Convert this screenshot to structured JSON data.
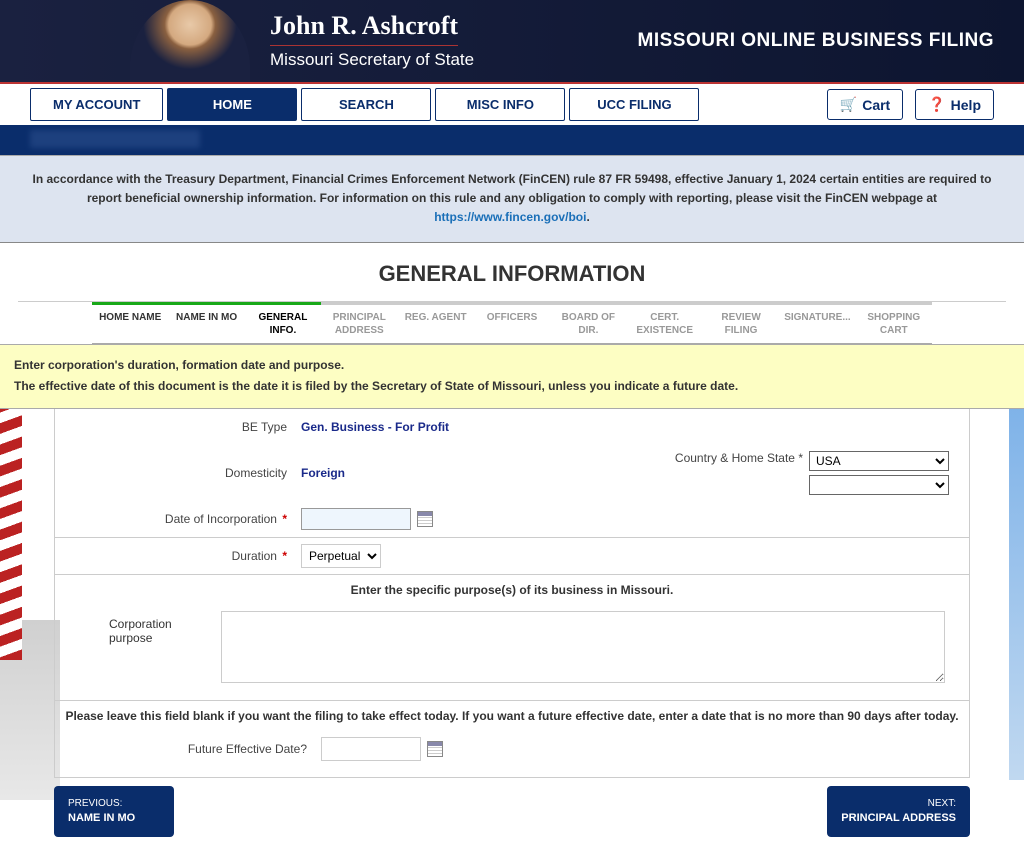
{
  "banner": {
    "name": "John R. Ashcroft",
    "title": "Missouri Secretary of State",
    "app": "MISSOURI ONLINE BUSINESS FILING"
  },
  "nav": {
    "my_account": "MY ACCOUNT",
    "home": "HOME",
    "search": "SEARCH",
    "misc": "MISC INFO",
    "ucc": "UCC FILING",
    "cart": "Cart",
    "help": "Help"
  },
  "notice": {
    "text1": "In accordance with the Treasury Department, Financial Crimes Enforcement Network (FinCEN) rule 87 FR 59498, effective January 1, 2024 certain entities are required to report beneficial ownership information. For information on this rule and any obligation to comply with reporting, please visit the FinCEN webpage at ",
    "link": "https://www.fincen.gov/boi"
  },
  "page_title": "GENERAL INFORMATION",
  "steps": [
    "HOME NAME",
    "NAME IN MO",
    "GENERAL INFO.",
    "PRINCIPAL ADDRESS",
    "REG. AGENT",
    "OFFICERS",
    "BOARD OF DIR.",
    "CERT. EXISTENCE",
    "REVIEW FILING",
    "SIGNATURE...",
    "SHOPPING CART"
  ],
  "instructions": {
    "line1": "Enter corporation's duration, formation date and purpose.",
    "line2": "The effective date of this document is the date it is filed by the Secretary of State of Missouri, unless you indicate a future date."
  },
  "form": {
    "be_type_label": "BE Type",
    "be_type_value": "Gen. Business - For Profit",
    "domesticity_label": "Domesticity",
    "domesticity_value": "Foreign",
    "country_label": "Country & Home State",
    "country_value": "USA",
    "home_state_value": "",
    "doi_label": "Date of Incorporation",
    "doi_value": "",
    "duration_label": "Duration",
    "duration_value": "Perpetual",
    "purpose_heading": "Enter the specific purpose(s) of its business in Missouri.",
    "purpose_label": "Corporation purpose",
    "purpose_value": "",
    "future_heading": "Please leave this field blank if you want the filing to take effect today. If you want a future effective date, enter a date that is no more than 90 days after today.",
    "future_label": "Future Effective Date?",
    "future_value": ""
  },
  "buttons": {
    "prev_small": "PREVIOUS:",
    "prev_big": "NAME IN MO",
    "next_small": "NEXT:",
    "next_big": "PRINCIPAL ADDRESS"
  }
}
